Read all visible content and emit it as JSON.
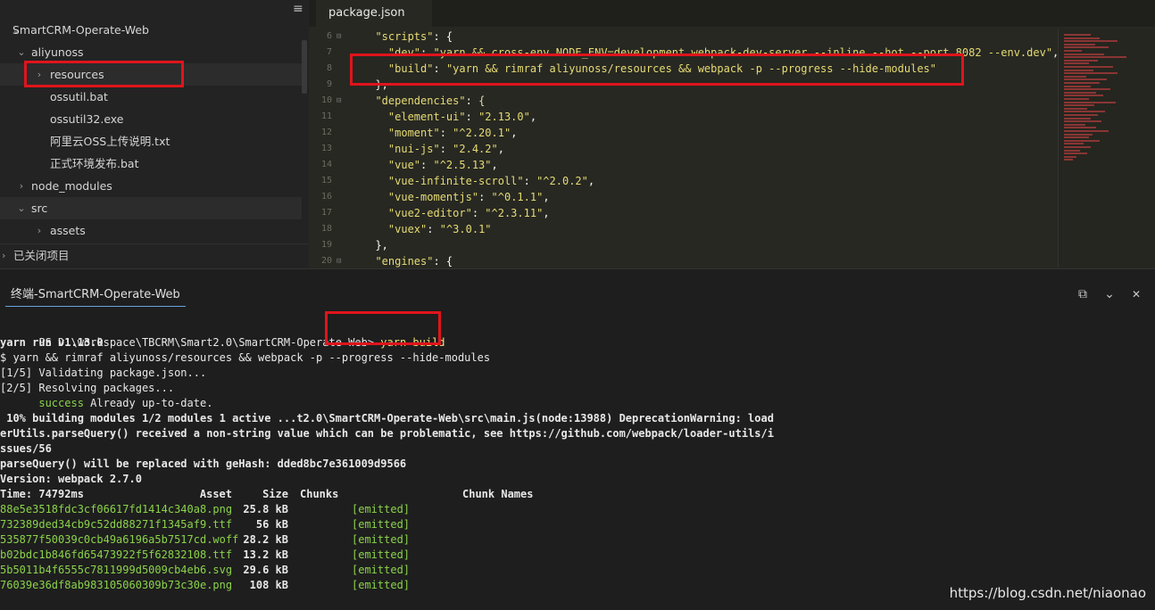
{
  "sidebar": {
    "items": [
      {
        "label": "SmartCRM-Operate-Web",
        "chevron": "⌄"
      },
      {
        "label": "aliyunoss",
        "chevron": "⌄"
      },
      {
        "label": "resources",
        "chevron": "›"
      },
      {
        "label": "ossutil.bat",
        "chevron": ""
      },
      {
        "label": "ossutil32.exe",
        "chevron": ""
      },
      {
        "label": "阿里云OSS上传说明.txt",
        "chevron": ""
      },
      {
        "label": "正式环境发布.bat",
        "chevron": ""
      },
      {
        "label": "node_modules",
        "chevron": "›"
      },
      {
        "label": "src",
        "chevron": "⌄"
      },
      {
        "label": "assets",
        "chevron": "›"
      }
    ],
    "closed_projects": "已关闭项目",
    "menu_icon": "≡"
  },
  "editor": {
    "tab": "package.json",
    "lines": [
      {
        "n": "6",
        "fold": "⊟",
        "parts": [
          [
            "p",
            "  "
          ],
          [
            "k",
            "\"scripts\""
          ],
          [
            "p",
            ": {"
          ]
        ]
      },
      {
        "n": "7",
        "fold": "",
        "parts": [
          [
            "p",
            "    "
          ],
          [
            "k",
            "\"dev\""
          ],
          [
            "p",
            ": "
          ],
          [
            "k",
            "\"yarn && cross-env NODE_ENV=development webpack-dev-server --inline --hot --port 8082 --env.dev\""
          ],
          [
            "p",
            ","
          ]
        ]
      },
      {
        "n": "8",
        "fold": "",
        "parts": [
          [
            "p",
            "    "
          ],
          [
            "k",
            "\"build\""
          ],
          [
            "p",
            ": "
          ],
          [
            "k",
            "\"yarn && rimraf aliyunoss/resources && webpack -p --progress --hide-modules\""
          ]
        ]
      },
      {
        "n": "9",
        "fold": "",
        "parts": [
          [
            "p",
            "  },"
          ]
        ]
      },
      {
        "n": "10",
        "fold": "⊟",
        "parts": [
          [
            "p",
            "  "
          ],
          [
            "k",
            "\"dependencies\""
          ],
          [
            "p",
            ": "
          ],
          [
            "b",
            "{"
          ]
        ]
      },
      {
        "n": "11",
        "fold": "",
        "parts": [
          [
            "p",
            "    "
          ],
          [
            "k",
            "\"element-ui\""
          ],
          [
            "p",
            ": "
          ],
          [
            "k",
            "\"2.13.0\""
          ],
          [
            "p",
            ","
          ]
        ]
      },
      {
        "n": "12",
        "fold": "",
        "parts": [
          [
            "p",
            "    "
          ],
          [
            "k",
            "\"moment\""
          ],
          [
            "p",
            ": "
          ],
          [
            "k",
            "\"^2.20.1\""
          ],
          [
            "p",
            ","
          ]
        ]
      },
      {
        "n": "13",
        "fold": "",
        "parts": [
          [
            "p",
            "    "
          ],
          [
            "k",
            "\"nui-js\""
          ],
          [
            "p",
            ": "
          ],
          [
            "k",
            "\"2.4.2\""
          ],
          [
            "p",
            ","
          ]
        ]
      },
      {
        "n": "14",
        "fold": "",
        "parts": [
          [
            "p",
            "    "
          ],
          [
            "k",
            "\"vue\""
          ],
          [
            "p",
            ": "
          ],
          [
            "k",
            "\"^2.5.13\""
          ],
          [
            "p",
            ","
          ]
        ]
      },
      {
        "n": "15",
        "fold": "",
        "parts": [
          [
            "p",
            "    "
          ],
          [
            "k",
            "\"vue-infinite-scroll\""
          ],
          [
            "p",
            ": "
          ],
          [
            "k",
            "\"^2.0.2\""
          ],
          [
            "p",
            ","
          ]
        ]
      },
      {
        "n": "16",
        "fold": "",
        "parts": [
          [
            "p",
            "    "
          ],
          [
            "k",
            "\"vue-momentjs\""
          ],
          [
            "p",
            ": "
          ],
          [
            "k",
            "\"^0.1.1\""
          ],
          [
            "p",
            ","
          ]
        ]
      },
      {
        "n": "17",
        "fold": "",
        "parts": [
          [
            "p",
            "    "
          ],
          [
            "k",
            "\"vue2-editor\""
          ],
          [
            "p",
            ": "
          ],
          [
            "k",
            "\"^2.3.11\""
          ],
          [
            "p",
            ","
          ]
        ]
      },
      {
        "n": "18",
        "fold": "",
        "parts": [
          [
            "p",
            "    "
          ],
          [
            "k",
            "\"vuex\""
          ],
          [
            "p",
            ": "
          ],
          [
            "k",
            "\"^3.0.1\""
          ]
        ]
      },
      {
        "n": "19",
        "fold": "",
        "parts": [
          [
            "p",
            "  },"
          ]
        ]
      },
      {
        "n": "20",
        "fold": "⊟",
        "parts": [
          [
            "p",
            "  "
          ],
          [
            "k",
            "\"engines\""
          ],
          [
            "p",
            ": {"
          ]
        ]
      }
    ]
  },
  "terminal": {
    "tab": "终端-SmartCRM-Operate-Web",
    "icons": {
      "new": "⧉",
      "collapse": "⌄",
      "close": "✕"
    },
    "prompt": "PS D:\\workspace\\TBCRM\\Smart2.0\\SmartCRM-Operate-Web> ",
    "command": "yarn build",
    "lines": [
      "yarn run v1.13.0",
      "$ yarn && rimraf aliyunoss/resources && webpack -p --progress --hide-modules",
      "[1/5] Validating package.json...",
      "[2/5] Resolving packages...",
      "",
      " 10% building modules 1/2 modules 1 active ...t2.0\\SmartCRM-Operate-Web\\src\\main.js(node:13988) DeprecationWarning: load",
      "erUtils.parseQuery() received a non-string value which can be problematic, see https://github.com/webpack/loader-utils/i",
      "ssues/56",
      "parseQuery() will be replaced with geHash: dded8bc7e361009d9566",
      "Version: webpack 2.7.0",
      "Time: 74792ms"
    ],
    "success_word": "success",
    "success_rest": " Already up-to-date.",
    "asset_headers": {
      "asset": "Asset",
      "size": "Size",
      "chunks": "Chunks",
      "chunk_names": "Chunk Names"
    },
    "assets": [
      {
        "name": "88e5e3518fdc3cf06617fd1414c340a8.png",
        "size": "25.8 kB",
        "status": "[emitted]"
      },
      {
        "name": "732389ded34cb9c52dd88271f1345af9.ttf",
        "size": "56 kB",
        "status": "[emitted]"
      },
      {
        "name": "535877f50039c0cb49a6196a5b7517cd.woff",
        "size": "28.2 kB",
        "status": "[emitted]"
      },
      {
        "name": "b02bdc1b846fd65473922f5f62832108.ttf",
        "size": "13.2 kB",
        "status": "[emitted]"
      },
      {
        "name": "5b5011b4f6555c7811999d5009cb4eb6.svg",
        "size": "29.6 kB",
        "status": "[emitted]"
      },
      {
        "name": "76039e36df8ab983105060309b73c30e.png",
        "size": "108 kB",
        "status": "[emitted]"
      }
    ]
  },
  "watermark": "https://blog.csdn.net/niaonao",
  "colors": {
    "highlight": "#e0141c",
    "string": "#e6db74",
    "emitted": "#8bd34a"
  }
}
